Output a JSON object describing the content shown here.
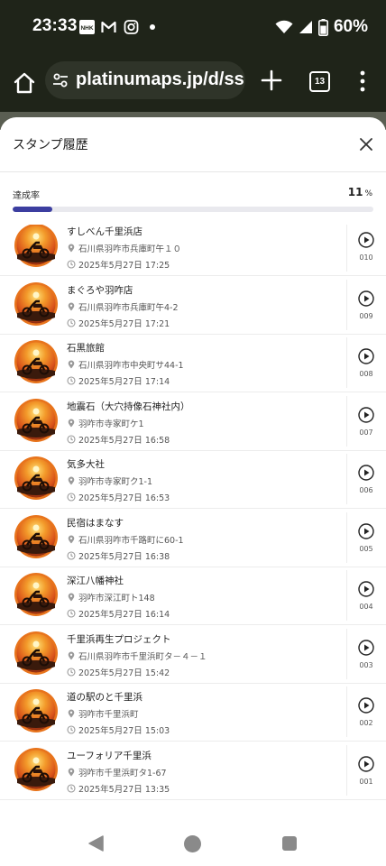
{
  "status_bar": {
    "time": "23:33",
    "notification_icons": [
      "nhk-icon",
      "gmail-icon",
      "instagram-icon"
    ],
    "battery": "60%"
  },
  "browser": {
    "url": "platinumaps.jp/d/ss",
    "tab_count": "13"
  },
  "sheet": {
    "title": "スタンプ履歴",
    "achievement_label": "達成率",
    "achievement_value": "11",
    "achievement_unit": "%",
    "achievement_fraction": 0.11
  },
  "stamps": [
    {
      "name": "すしべん千里浜店",
      "address": "石川県羽咋市兵庫町午１０",
      "date": "2025年5月27日 17:25",
      "number": "010"
    },
    {
      "name": "まぐろや羽咋店",
      "address": "石川県羽咋市兵庫町午4-2",
      "date": "2025年5月27日 17:21",
      "number": "009"
    },
    {
      "name": "石黒旅館",
      "address": "石川県羽咋市中央町サ44-1",
      "date": "2025年5月27日 17:14",
      "number": "008"
    },
    {
      "name": "地震石（大穴持像石神社内）",
      "address": "羽咋市寺家町ケ1",
      "date": "2025年5月27日 16:58",
      "number": "007"
    },
    {
      "name": "気多大社",
      "address": "羽咋市寺家町ク1-1",
      "date": "2025年5月27日 16:53",
      "number": "006"
    },
    {
      "name": "民宿はまなす",
      "address": "石川県羽咋市千路町に60-1",
      "date": "2025年5月27日 16:38",
      "number": "005"
    },
    {
      "name": "深江八幡神社",
      "address": "羽咋市深江町ト148",
      "date": "2025年5月27日 16:14",
      "number": "004"
    },
    {
      "name": "千里浜再生プロジェクト",
      "address": "石川県羽咋市千里浜町タ－４－１",
      "date": "2025年5月27日 15:42",
      "number": "003"
    },
    {
      "name": "道の駅のと千里浜",
      "address": "羽咋市千里浜町",
      "date": "2025年5月27日 15:03",
      "number": "002"
    },
    {
      "name": "ユーフォリア千里浜",
      "address": "羽咋市千里浜町タ1-67",
      "date": "2025年5月27日 13:35",
      "number": "001"
    }
  ],
  "colors": {
    "progress_fill": "#3c3ea0",
    "status_bar_bg": "#1f2419",
    "accent_orange": "#e8741c"
  }
}
